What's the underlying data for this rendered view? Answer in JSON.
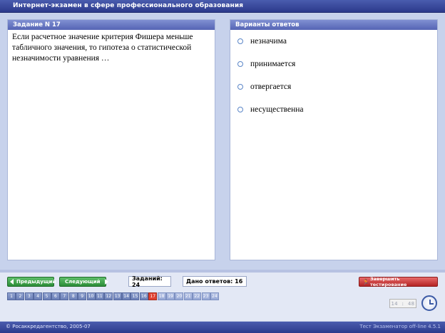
{
  "window": {
    "title": "Интернет-экзамен в сфере профессионального образования"
  },
  "question": {
    "header": "Задание N 17",
    "text": "Если расчетное значение критерия Фишера меньше табличного значения, то гипотеза о статистической незначимости уравнения …"
  },
  "answers": {
    "header": "Варианты ответов",
    "options": [
      "незначима",
      "принимается",
      "отвергается",
      "несущественна"
    ]
  },
  "nav": {
    "prev_label": "Предыдущий",
    "next_label": "Следующий",
    "tasks_label": "Заданий: 24",
    "answered_label": "Дано ответов: 16",
    "finish_label": "Завершить тестирование"
  },
  "pages": {
    "items": [
      "1",
      "2",
      "3",
      "4",
      "5",
      "6",
      "7",
      "8",
      "9",
      "10",
      "11",
      "12",
      "13",
      "14",
      "15",
      "16",
      "17",
      "18",
      "19",
      "20",
      "21",
      "22",
      "23",
      "24"
    ],
    "current": "17"
  },
  "timer": {
    "value": "14 : 48"
  },
  "footer": {
    "copyright": "© Росаккредагентство, 2005-07",
    "version": "Тест Экзаменатор off-line 4.5.1"
  },
  "colors": {
    "header_bg": "#2c3a8c",
    "nav_green": "#2c8d38",
    "finish_red": "#b42424",
    "current_page": "#e04030"
  }
}
